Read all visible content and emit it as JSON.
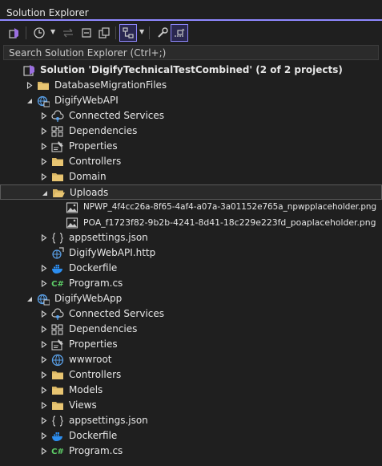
{
  "panel": {
    "title": "Solution Explorer",
    "accent_color": "#8f88ff"
  },
  "toolbar": {
    "buttons": [
      {
        "name": "vs-switch-views-icon"
      },
      {
        "name": "history-icon"
      },
      {
        "name": "sync-icon"
      },
      {
        "name": "collapse-all-icon"
      },
      {
        "name": "show-all-files-icon"
      },
      {
        "name": "filter-pending-changes-icon",
        "selected": true
      },
      {
        "name": "properties-wrench-icon"
      },
      {
        "name": "preview-selected-icon",
        "selected": true
      }
    ]
  },
  "search": {
    "placeholder": "Search Solution Explorer (Ctrl+;)"
  },
  "tree": [
    {
      "label": "Solution 'DigifyTechnicalTestCombined' (2 of 2 projects)",
      "depth": 0,
      "expander": "none",
      "icon": "solution-icon",
      "type": "solution"
    },
    {
      "label": "DatabaseMigrationFiles",
      "depth": 1,
      "expander": "collapsed",
      "icon": "folder-icon"
    },
    {
      "label": "DigifyWebAPI",
      "depth": 1,
      "expander": "expanded",
      "icon": "web-project-icon"
    },
    {
      "label": "Connected Services",
      "depth": 2,
      "expander": "collapsed",
      "icon": "connected-services-icon"
    },
    {
      "label": "Dependencies",
      "depth": 2,
      "expander": "collapsed",
      "icon": "dependencies-icon"
    },
    {
      "label": "Properties",
      "depth": 2,
      "expander": "collapsed",
      "icon": "properties-icon"
    },
    {
      "label": "Controllers",
      "depth": 2,
      "expander": "collapsed",
      "icon": "folder-icon"
    },
    {
      "label": "Domain",
      "depth": 2,
      "expander": "collapsed",
      "icon": "folder-icon"
    },
    {
      "label": "Uploads",
      "depth": 2,
      "expander": "expanded",
      "icon": "folder-open-icon",
      "selected": true
    },
    {
      "label": "NPWP_4f4cc26a-8f65-4af4-a07a-3a01152e765a_npwpplaceholder.png",
      "depth": 3,
      "expander": "none",
      "icon": "image-file-icon"
    },
    {
      "label": "POA_f1723f82-9b2b-4241-8d41-18c229e223fd_poaplaceholder.png",
      "depth": 3,
      "expander": "none",
      "icon": "image-file-icon"
    },
    {
      "label": "appsettings.json",
      "depth": 2,
      "expander": "collapsed",
      "icon": "json-file-icon"
    },
    {
      "label": "DigifyWebAPI.http",
      "depth": 2,
      "expander": "none",
      "icon": "http-file-icon"
    },
    {
      "label": "Dockerfile",
      "depth": 2,
      "expander": "collapsed",
      "icon": "docker-icon"
    },
    {
      "label": "Program.cs",
      "depth": 2,
      "expander": "collapsed",
      "icon": "csharp-file-icon"
    },
    {
      "label": "DigifyWebApp",
      "depth": 1,
      "expander": "expanded",
      "icon": "web-project-icon"
    },
    {
      "label": "Connected Services",
      "depth": 2,
      "expander": "collapsed",
      "icon": "connected-services-icon"
    },
    {
      "label": "Dependencies",
      "depth": 2,
      "expander": "collapsed",
      "icon": "dependencies-icon"
    },
    {
      "label": "Properties",
      "depth": 2,
      "expander": "collapsed",
      "icon": "properties-icon"
    },
    {
      "label": "wwwroot",
      "depth": 2,
      "expander": "collapsed",
      "icon": "globe-icon"
    },
    {
      "label": "Controllers",
      "depth": 2,
      "expander": "collapsed",
      "icon": "folder-icon"
    },
    {
      "label": "Models",
      "depth": 2,
      "expander": "collapsed",
      "icon": "folder-icon"
    },
    {
      "label": "Views",
      "depth": 2,
      "expander": "collapsed",
      "icon": "folder-icon"
    },
    {
      "label": "appsettings.json",
      "depth": 2,
      "expander": "collapsed",
      "icon": "json-file-icon"
    },
    {
      "label": "Dockerfile",
      "depth": 2,
      "expander": "collapsed",
      "icon": "docker-icon"
    },
    {
      "label": "Program.cs",
      "depth": 2,
      "expander": "collapsed",
      "icon": "csharp-file-icon"
    }
  ],
  "csharp_glyph": "C#"
}
